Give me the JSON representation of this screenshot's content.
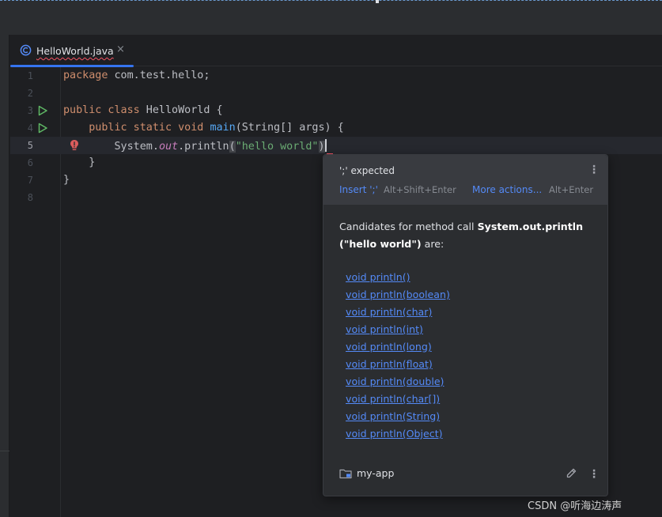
{
  "editor": {
    "tab": {
      "label": "HelloWorld.java",
      "close": "×"
    },
    "lines": [
      {
        "num": "1",
        "text": "package com.test.hello;"
      },
      {
        "num": "2",
        "text": ""
      },
      {
        "num": "3",
        "text": "public class HelloWorld {"
      },
      {
        "num": "4",
        "text": "    public static void main(String[] args) {"
      },
      {
        "num": "5",
        "text": "        System.out.println(\"hello world\")"
      },
      {
        "num": "6",
        "text": "    }"
      },
      {
        "num": "7",
        "text": "}"
      },
      {
        "num": "8",
        "text": ""
      }
    ],
    "current_line": 5
  },
  "popup": {
    "error_message": "';' expected",
    "insert_action": "Insert ';'",
    "insert_shortcut": "Alt+Shift+Enter",
    "more_actions": "More actions...",
    "more_shortcut": "Alt+Enter",
    "candidates_intro": "Candidates for method call ",
    "candidates_call": "System.out.println (\"hello world\")",
    "candidates_suffix": " are:",
    "methods": [
      "void println()",
      "void println(boolean)",
      "void println(char)",
      "void println(int)",
      "void println(long)",
      "void println(float)",
      "void println(double)",
      "void println(char[])",
      "void println(String)",
      "void println(Object)"
    ],
    "project": "my-app"
  },
  "watermark": "CSDN @听海边涛声",
  "colors": {
    "background": "#1e1f22",
    "keyword": "#cf8e6d",
    "function": "#56a8f5",
    "string": "#6aab73",
    "static_field": "#c77dbb",
    "link": "#548af7",
    "error": "#f75464",
    "run_green": "#5fb865"
  }
}
